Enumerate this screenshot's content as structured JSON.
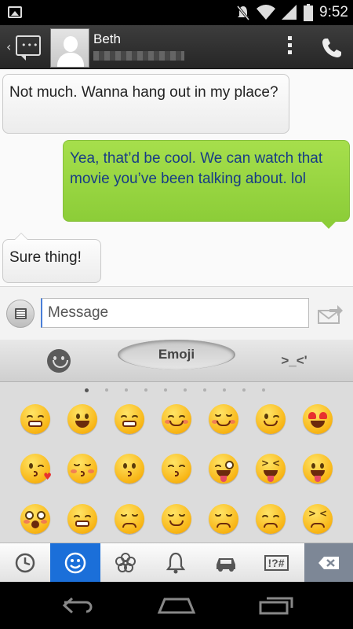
{
  "status_bar": {
    "time": "9:52",
    "icons": [
      "image-notification-icon",
      "muted-icon",
      "wifi-icon",
      "signal-icon",
      "battery-icon"
    ]
  },
  "header": {
    "contact_name": "Beth",
    "contact_number_redacted": true,
    "icons": [
      "messaging-back-icon",
      "contact-avatar",
      "overflow-menu-icon",
      "phone-call-icon"
    ]
  },
  "conversation": {
    "messages": [
      {
        "direction": "incoming",
        "text": "Not much. Wanna hang out in my place?"
      },
      {
        "direction": "outgoing",
        "text": "Yea, that’d be cool. We can watch that movie you’ve been talking about. lol"
      },
      {
        "direction": "incoming",
        "text": "Sure thing!"
      }
    ],
    "colors": {
      "incoming_bg": "#f5f5f5",
      "outgoing_bg": "#99d642",
      "outgoing_text": "#173c86"
    }
  },
  "composer": {
    "placeholder": "Message",
    "value": ""
  },
  "keyboard": {
    "tabs": [
      {
        "id": "smiley",
        "label": "",
        "icon": "smiley-icon"
      },
      {
        "id": "emoji",
        "label": "Emoji",
        "selected": true
      },
      {
        "id": "emoticon",
        "label": ">_<'"
      }
    ],
    "page_count": 10,
    "current_page": 1,
    "emoji_rows": [
      [
        "grinning",
        "smiley",
        "blush-smile",
        "smile",
        "relaxed",
        "wink",
        "heart-eyes"
      ],
      [
        "kissing-heart",
        "kissing-closed-eyes",
        "kissing",
        "kissing-smiling-eyes",
        "stuck-out-tongue-winking-eye",
        "stuck-out-tongue-closed-eyes",
        "stuck-out-tongue"
      ],
      [
        "flushed",
        "grin",
        "pensive",
        "relieved",
        "unamused",
        "disappointed",
        "persevere"
      ]
    ],
    "categories": [
      {
        "id": "recent",
        "icon": "clock-icon"
      },
      {
        "id": "people",
        "icon": "smiley-icon",
        "active": true
      },
      {
        "id": "nature",
        "icon": "flower-icon"
      },
      {
        "id": "objects",
        "icon": "bell-icon"
      },
      {
        "id": "places",
        "icon": "car-icon"
      },
      {
        "id": "symbols",
        "label": "!?#"
      },
      {
        "id": "delete",
        "icon": "backspace-icon"
      }
    ],
    "accent_color": "#1b6fd9"
  },
  "nav_bar": {
    "icons": [
      "back-icon",
      "home-icon",
      "recent-apps-icon"
    ]
  }
}
